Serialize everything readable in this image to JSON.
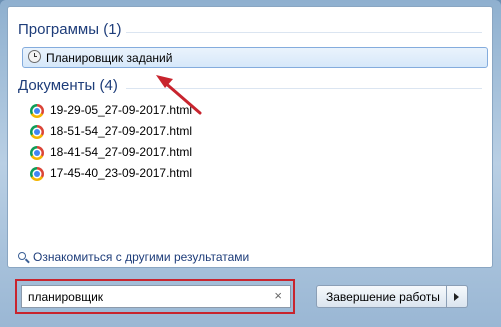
{
  "programs": {
    "header": "Программы (1)",
    "items": [
      {
        "label": "Планировщик заданий",
        "icon": "clock-icon"
      }
    ]
  },
  "documents": {
    "header": "Документы (4)",
    "items": [
      {
        "label": "19-29-05_27-09-2017.html",
        "icon": "chrome-icon"
      },
      {
        "label": "18-51-54_27-09-2017.html",
        "icon": "chrome-icon"
      },
      {
        "label": "18-41-54_27-09-2017.html",
        "icon": "chrome-icon"
      },
      {
        "label": "17-45-40_23-09-2017.html",
        "icon": "chrome-icon"
      }
    ]
  },
  "more_results": {
    "label": "Ознакомиться с другими результатами",
    "icon": "search-icon"
  },
  "search": {
    "value": "планировщик",
    "clear_icon": "×"
  },
  "shutdown": {
    "label": "Завершение работы"
  },
  "colors": {
    "highlight": "#c8242e",
    "header_text": "#1e3d7a",
    "selection": "#d6e8fa"
  }
}
